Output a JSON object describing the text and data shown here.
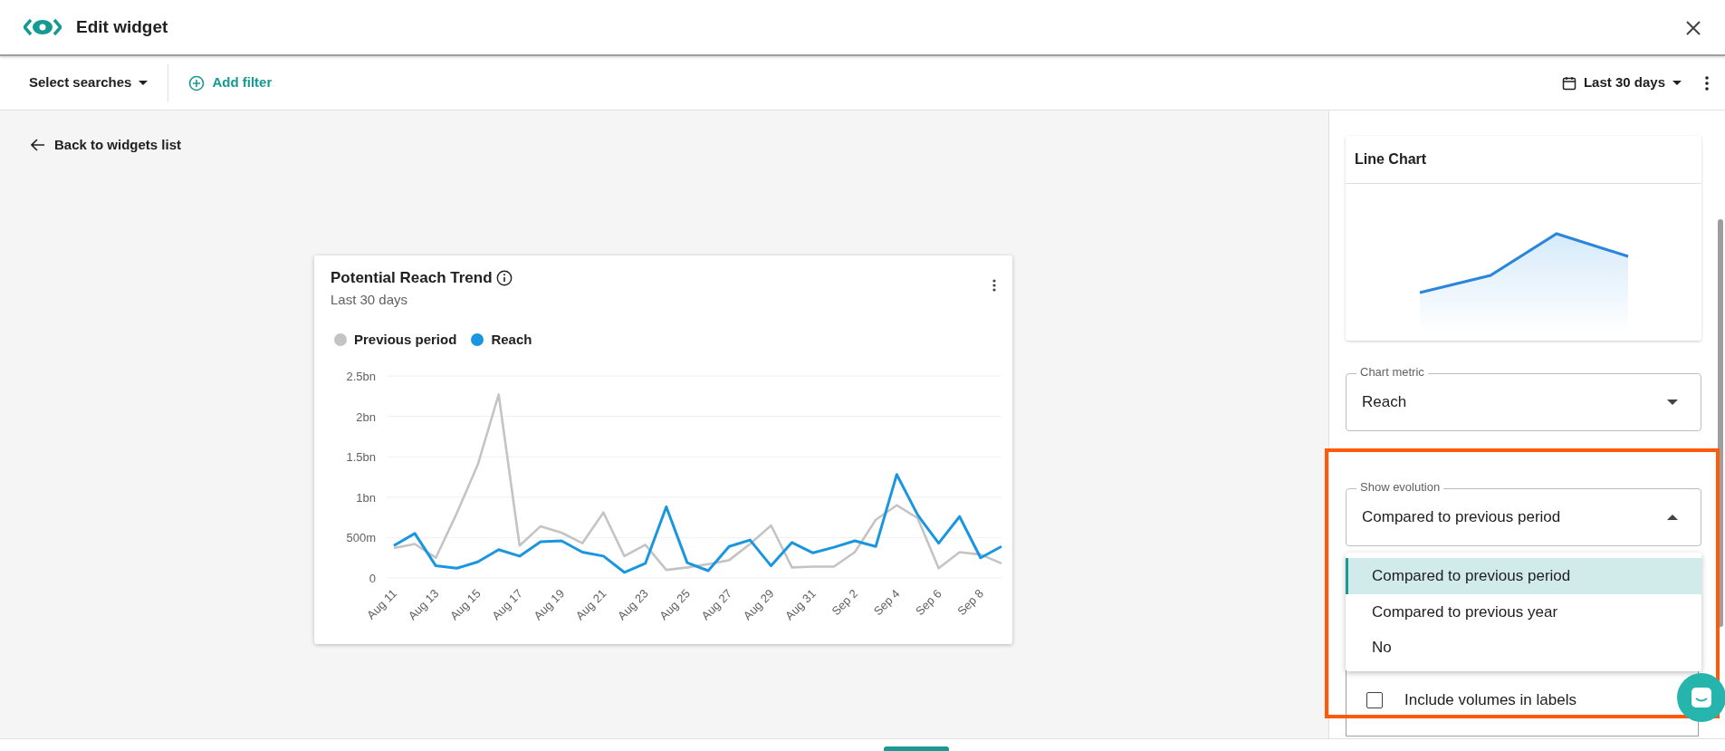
{
  "header": {
    "title": "Edit widget"
  },
  "toolbar": {
    "searches_label": "Select searches",
    "add_filter": "Add filter",
    "date_range": "Last 30 days"
  },
  "back_link": "Back to widgets list",
  "widget": {
    "title": "Potential Reach Trend",
    "subtitle": "Last 30 days",
    "chart_data": {
      "type": "line",
      "categories": [
        "Aug 11",
        null,
        "Aug 13",
        null,
        "Aug 15",
        null,
        "Aug 17",
        null,
        "Aug 19",
        null,
        "Aug 21",
        null,
        "Aug 23",
        null,
        "Aug 25",
        null,
        "Aug 27",
        null,
        "Aug 29",
        null,
        "Aug 31",
        null,
        "Sep 2",
        null,
        "Sep 4",
        null,
        "Sep 6",
        null,
        "Sep 8",
        null
      ],
      "ylim": [
        0,
        2500000000
      ],
      "grid": true,
      "yticks": [
        {
          "value": 0,
          "label": "0"
        },
        {
          "value": 500000000,
          "label": "500m"
        },
        {
          "value": 1000000000,
          "label": "1bn"
        },
        {
          "value": 1500000000,
          "label": "1.5bn"
        },
        {
          "value": 2000000000,
          "label": "2bn"
        },
        {
          "value": 2500000000,
          "label": "2.5bn"
        }
      ],
      "series": [
        {
          "name": "Previous period",
          "color": "#c4c4c4",
          "values": [
            370000000,
            420000000,
            250000000,
            800000000,
            1400000000,
            2270000000,
            400000000,
            640000000,
            560000000,
            430000000,
            810000000,
            270000000,
            410000000,
            100000000,
            130000000,
            170000000,
            220000000,
            420000000,
            650000000,
            130000000,
            140000000,
            140000000,
            320000000,
            720000000,
            900000000,
            740000000,
            120000000,
            320000000,
            290000000,
            180000000
          ]
        },
        {
          "name": "Reach",
          "color": "#1a96e0",
          "values": [
            400000000,
            550000000,
            150000000,
            120000000,
            200000000,
            350000000,
            270000000,
            450000000,
            460000000,
            320000000,
            270000000,
            70000000,
            180000000,
            880000000,
            190000000,
            90000000,
            390000000,
            470000000,
            150000000,
            440000000,
            310000000,
            380000000,
            460000000,
            390000000,
            1280000000,
            780000000,
            430000000,
            760000000,
            250000000,
            390000000
          ]
        }
      ]
    }
  },
  "side_panel": {
    "chart_type": {
      "title": "Line Chart"
    },
    "chart_metric": {
      "label": "Chart metric",
      "value": "Reach"
    },
    "show_evolution": {
      "label": "Show evolution",
      "value": "Compared to previous period",
      "expanded": true,
      "options": [
        {
          "label": "Compared to previous period",
          "selected": true
        },
        {
          "label": "Compared to previous year",
          "selected": false
        },
        {
          "label": "No",
          "selected": false
        }
      ]
    },
    "legend_options": [
      {
        "label": "Include volumes in labels",
        "checked": false
      }
    ]
  }
}
